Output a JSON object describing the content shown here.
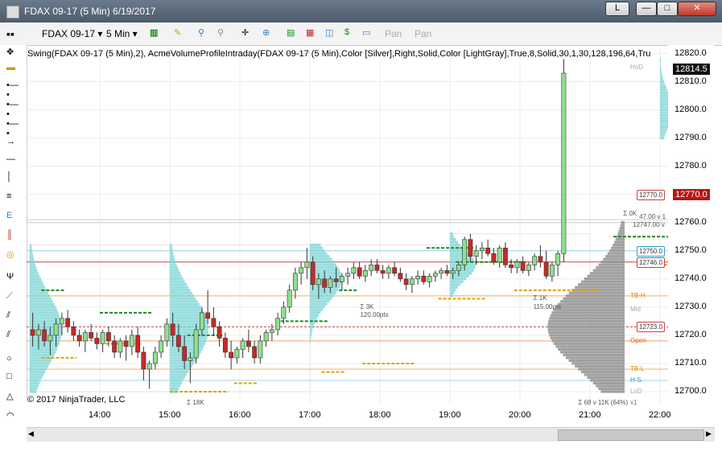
{
  "window": {
    "title": "FDAX 09-17 (5 Min)  6/19/2017",
    "link_button": "L",
    "minimize": "—",
    "maximize": "□",
    "close": "✕"
  },
  "toolbar": {
    "instrument": "FDAX 09-17",
    "interval": "5 Min",
    "pan1": "Pan",
    "pan2": "Pan"
  },
  "indicator_label": "Swing(FDAX 09-17 (5 Min),2), AcmeVolumeProfileIntraday(FDAX 09-17 (5 Min),Color [Silver],Right,Solid,Color [LightGray],True,8,Solid,30,1,30,128,196,64,Tru",
  "copyright": "© 2017 NinjaTrader, LLC",
  "price_tags": {
    "last_price": "12814.5",
    "marker_price": "12770.0"
  },
  "level_tags": [
    {
      "text": "12770.0",
      "y": 12770,
      "color": "#d04040"
    },
    {
      "text": "12750.0",
      "y": 12750,
      "color": "#2aa3c9"
    },
    {
      "text": "12746.0",
      "y": 12746,
      "color": "#d04040"
    },
    {
      "text": "12723.0",
      "y": 12723,
      "color": "#d04040"
    }
  ],
  "level_notes": [
    {
      "text": "TB-H",
      "y": 12734,
      "color": "#e08a00"
    },
    {
      "text": "Mid",
      "y": 12729,
      "color": "#aaaaaa"
    },
    {
      "text": "Open",
      "y": 12718,
      "color": "#e05a20"
    },
    {
      "text": "TB-L",
      "y": 12708,
      "color": "#e08a00"
    },
    {
      "text": "H-S",
      "y": 12704,
      "color": "#2aa3c9"
    },
    {
      "text": "LoD",
      "y": 12700,
      "color": "#aaaaaa"
    },
    {
      "text": "x1",
      "y": 12696,
      "color": "#777777"
    },
    {
      "text": "HoD",
      "y": 12815,
      "color": "#aaaaaa"
    }
  ],
  "profile_notes": [
    {
      "text": "Σ 3K",
      "x": 0.52,
      "y": 12730
    },
    {
      "text": "120.00pts",
      "x": 0.52,
      "y": 12727
    },
    {
      "text": "Σ 1K",
      "x": 0.79,
      "y": 12733
    },
    {
      "text": "115.00pts",
      "x": 0.79,
      "y": 12730
    },
    {
      "text": "Σ 18K",
      "x": 0.25,
      "y": 12696
    },
    {
      "text": "Σ 68 v 11K (64%)",
      "x": 0.86,
      "y": 12696
    },
    {
      "text": "Σ 0K",
      "x": 0.93,
      "y": 12763
    },
    {
      "text": "47.00 v 1",
      "x": 0.955,
      "y": 12762
    },
    {
      "text": "12747.00 v",
      "x": 0.945,
      "y": 12759
    }
  ],
  "chart_data": {
    "type": "candlestick",
    "instrument": "FDAX 09-17",
    "interval": "5 Min",
    "ylim": [
      12696,
      12823
    ],
    "y_ticks": [
      12700.0,
      12710.0,
      12720.0,
      12730.0,
      12740.0,
      12750.0,
      12760.0,
      12770.0,
      12780.0,
      12790.0,
      12800.0,
      12810.0,
      12820.0
    ],
    "x_ticks": [
      "14:00",
      "15:00",
      "16:00",
      "17:00",
      "18:00",
      "19:00",
      "20:00",
      "21:00",
      "22:00"
    ],
    "x_tick_bar_index": [
      12,
      24,
      36,
      48,
      60,
      72,
      84,
      96,
      108
    ],
    "bars": [
      [
        12722,
        12728,
        12716,
        12720
      ],
      [
        12720,
        12724,
        12715,
        12722
      ],
      [
        12722,
        12725,
        12716,
        12718
      ],
      [
        12718,
        12723,
        12713,
        12720
      ],
      [
        12720,
        12726,
        12716,
        12724
      ],
      [
        12724,
        12728,
        12720,
        12726
      ],
      [
        12726,
        12729,
        12721,
        12723
      ],
      [
        12723,
        12725,
        12718,
        12720
      ],
      [
        12720,
        12722,
        12716,
        12718
      ],
      [
        12718,
        12722,
        12714,
        12721
      ],
      [
        12721,
        12724,
        12718,
        12719
      ],
      [
        12719,
        12721,
        12715,
        12717
      ],
      [
        12717,
        12722,
        12714,
        12721
      ],
      [
        12721,
        12723,
        12716,
        12718
      ],
      [
        12718,
        12720,
        12712,
        12714
      ],
      [
        12714,
        12719,
        12712,
        12718
      ],
      [
        12718,
        12720,
        12711,
        12716
      ],
      [
        12716,
        12722,
        12713,
        12720
      ],
      [
        12720,
        12723,
        12712,
        12714
      ],
      [
        12714,
        12716,
        12704,
        12708
      ],
      [
        12708,
        12711,
        12701,
        12710
      ],
      [
        12710,
        12716,
        12708,
        12714
      ],
      [
        12714,
        12720,
        12712,
        12718
      ],
      [
        12718,
        12726,
        12716,
        12724
      ],
      [
        12724,
        12728,
        12716,
        12720
      ],
      [
        12720,
        12724,
        12714,
        12716
      ],
      [
        12716,
        12720,
        12708,
        12711
      ],
      [
        12711,
        12714,
        12703,
        12712
      ],
      [
        12712,
        12724,
        12710,
        12722
      ],
      [
        12722,
        12730,
        12720,
        12728
      ],
      [
        12728,
        12736,
        12724,
        12726
      ],
      [
        12726,
        12730,
        12720,
        12723
      ],
      [
        12723,
        12725,
        12716,
        12719
      ],
      [
        12719,
        12721,
        12712,
        12714
      ],
      [
        12714,
        12718,
        12708,
        12712
      ],
      [
        12712,
        12716,
        12710,
        12715
      ],
      [
        12715,
        12719,
        12712,
        12718
      ],
      [
        12718,
        12722,
        12714,
        12716
      ],
      [
        12716,
        12718,
        12710,
        12712
      ],
      [
        12712,
        12720,
        12710,
        12718
      ],
      [
        12718,
        12722,
        12716,
        12721
      ],
      [
        12721,
        12724,
        12718,
        12722
      ],
      [
        12722,
        12728,
        12720,
        12726
      ],
      [
        12726,
        12732,
        12724,
        12730
      ],
      [
        12730,
        12738,
        12728,
        12736
      ],
      [
        12736,
        12744,
        12733,
        12742
      ],
      [
        12742,
        12746,
        12738,
        12744
      ],
      [
        12744,
        12751,
        12740,
        12746
      ],
      [
        12746,
        12748,
        12736,
        12738
      ],
      [
        12738,
        12742,
        12733,
        12740
      ],
      [
        12740,
        12743,
        12735,
        12737
      ],
      [
        12737,
        12741,
        12735,
        12740
      ],
      [
        12740,
        12744,
        12737,
        12739
      ],
      [
        12739,
        12742,
        12736,
        12741
      ],
      [
        12741,
        12744,
        12738,
        12742
      ],
      [
        12742,
        12746,
        12740,
        12744
      ],
      [
        12744,
        12746,
        12740,
        12741
      ],
      [
        12741,
        12745,
        12739,
        12743
      ],
      [
        12743,
        12747,
        12741,
        12745
      ],
      [
        12745,
        12747,
        12742,
        12743
      ],
      [
        12743,
        12745,
        12740,
        12742
      ],
      [
        12742,
        12745,
        12740,
        12744
      ],
      [
        12744,
        12746,
        12741,
        12742
      ],
      [
        12742,
        12744,
        12739,
        12740
      ],
      [
        12740,
        12742,
        12736,
        12738
      ],
      [
        12738,
        12741,
        12735,
        12740
      ],
      [
        12740,
        12743,
        12738,
        12741
      ],
      [
        12741,
        12743,
        12738,
        12739
      ],
      [
        12739,
        12742,
        12737,
        12741
      ],
      [
        12741,
        12743,
        12739,
        12742
      ],
      [
        12742,
        12744,
        12740,
        12743
      ],
      [
        12743,
        12745,
        12741,
        12742
      ],
      [
        12742,
        12744,
        12740,
        12743
      ],
      [
        12743,
        12746,
        12741,
        12745
      ],
      [
        12745,
        12755,
        12743,
        12754
      ],
      [
        12754,
        12756,
        12746,
        12748
      ],
      [
        12748,
        12752,
        12745,
        12750
      ],
      [
        12750,
        12753,
        12747,
        12751
      ],
      [
        12751,
        12754,
        12748,
        12749
      ],
      [
        12749,
        12751,
        12745,
        12746
      ],
      [
        12746,
        12752,
        12744,
        12751
      ],
      [
        12751,
        12753,
        12744,
        12745
      ],
      [
        12745,
        12747,
        12742,
        12744
      ],
      [
        12744,
        12747,
        12742,
        12746
      ],
      [
        12746,
        12748,
        12742,
        12743
      ],
      [
        12743,
        12746,
        12741,
        12745
      ],
      [
        12745,
        12749,
        12743,
        12748
      ],
      [
        12748,
        12752,
        12744,
        12746
      ],
      [
        12746,
        12750,
        12740,
        12741
      ],
      [
        12741,
        12746,
        12739,
        12745
      ],
      [
        12745,
        12750,
        12741,
        12749
      ],
      [
        12749,
        12818,
        12746,
        12813
      ]
    ],
    "swing_highs": [
      {
        "from": 2,
        "to": 6,
        "y": 12736
      },
      {
        "from": 12,
        "to": 21,
        "y": 12728
      },
      {
        "from": 27,
        "to": 33,
        "y": 12720
      },
      {
        "from": 43,
        "to": 51,
        "y": 12725
      },
      {
        "from": 53,
        "to": 56,
        "y": 12736
      },
      {
        "from": 68,
        "to": 76,
        "y": 12751
      },
      {
        "from": 73,
        "to": 85,
        "y": 12746
      },
      {
        "from": 100,
        "to": 110,
        "y": 12755
      }
    ],
    "swing_lows": [
      {
        "from": 2,
        "to": 8,
        "y": 12712
      },
      {
        "from": 13,
        "to": 19,
        "y": 12717
      },
      {
        "from": 24,
        "to": 34,
        "y": 12700
      },
      {
        "from": 35,
        "to": 39,
        "y": 12703
      },
      {
        "from": 50,
        "to": 54,
        "y": 12707
      },
      {
        "from": 57,
        "to": 66,
        "y": 12710
      },
      {
        "from": 70,
        "to": 78,
        "y": 12733
      },
      {
        "from": 83,
        "to": 98,
        "y": 12736
      },
      {
        "from": 107,
        "to": 113,
        "y": 12745
      }
    ],
    "horizontal_levels": [
      {
        "y": 12723,
        "color": "#d04040",
        "style": "dashed"
      },
      {
        "y": 12746,
        "color": "#d04040",
        "style": "solid"
      },
      {
        "y": 12750,
        "color": "#9fd4e6",
        "style": "solid"
      },
      {
        "y": 12734,
        "color": "#f0b060",
        "style": "solid"
      },
      {
        "y": 12718,
        "color": "#f0a070",
        "style": "solid"
      },
      {
        "y": 12708,
        "color": "#f0b060",
        "style": "solid"
      },
      {
        "y": 12704,
        "color": "#9fd4e6",
        "style": "solid"
      },
      {
        "y": 12760,
        "color": "#cccccc",
        "style": "solid"
      },
      {
        "y": 12761,
        "color": "#cccccc",
        "style": "solid"
      }
    ],
    "profiles": [
      {
        "start": 0,
        "low": 12700,
        "high": 12752,
        "poc": 12722,
        "color": "#7fd6d6",
        "max": 0.05
      },
      {
        "start": 24,
        "low": 12700,
        "high": 12752,
        "poc": 12722,
        "color": "#7fd6d6",
        "max": 0.06
      },
      {
        "start": 48,
        "low": 12718,
        "high": 12752,
        "poc": 12740,
        "color": "#7fd6d6",
        "max": 0.05
      },
      {
        "start": 72,
        "low": 12734,
        "high": 12756,
        "poc": 12745,
        "color": "#7fd6d6",
        "max": 0.04
      },
      {
        "start": 108,
        "low": 12790,
        "high": 12818,
        "poc": 12800,
        "color": "#7fd6d6",
        "max": 0.02
      }
    ],
    "session_profile": {
      "low": 12700,
      "high": 12760,
      "poc": 12723,
      "color": "#909090",
      "max": 0.12
    },
    "colors": {
      "up": "#8fe08f",
      "down": "#c82828",
      "swing_high": "#1a8a1a",
      "swing_low": "#e0a000",
      "last_price_tag": "#111111",
      "marker_tag": "#b51616"
    }
  }
}
